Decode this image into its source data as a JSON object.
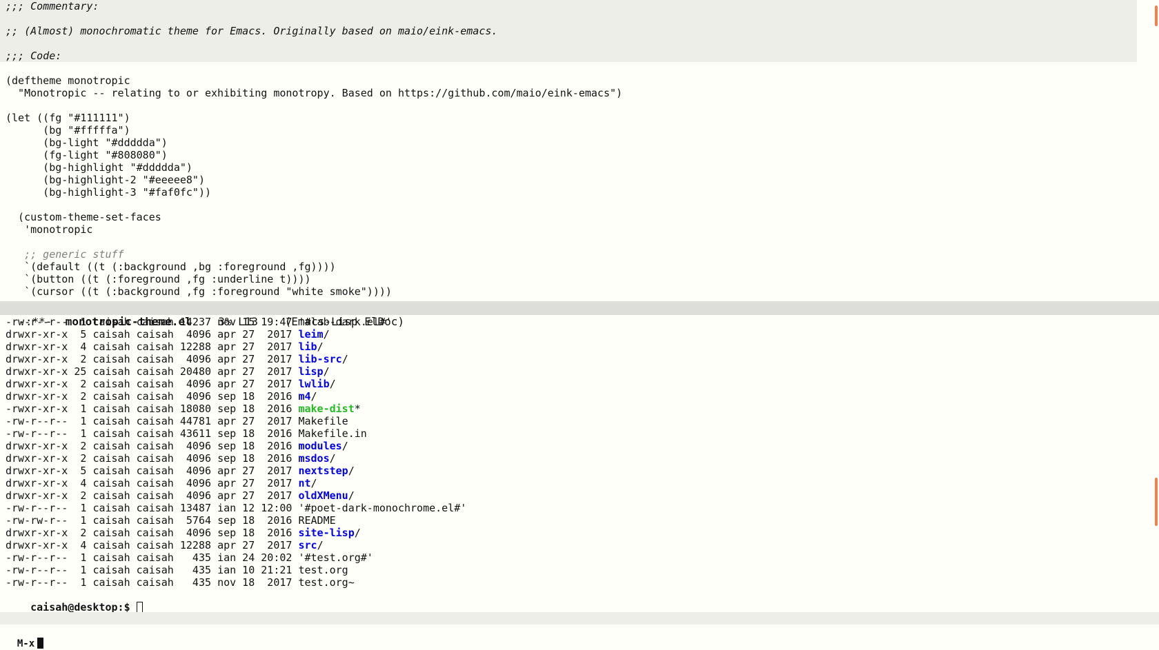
{
  "editor": {
    "commentary_lines": [
      ";;; Commentary:",
      "",
      ";; (Almost) monochromatic theme for Emacs. Originally based on maio/eink-emacs.",
      "",
      ";;; Code:"
    ],
    "code_lines": [
      "",
      "(deftheme monotropic",
      "  \"Monotropic -- relating to or exhibiting monotropy. Based on https://github.com/maio/eink-emacs\")",
      "",
      "(let ((fg \"#111111\")",
      "      (bg \"#fffffa\")",
      "      (bg-light \"#ddddda\")",
      "      (fg-light \"#808080\")",
      "      (bg-highlight \"#ddddda\")",
      "      (bg-highlight-2 \"#eeeee8\")",
      "      (bg-highlight-3 \"#faf0fc\"))",
      "",
      "  (custom-theme-set-faces",
      "   'monotropic",
      ""
    ],
    "generic_comment": "   ;; generic stuff",
    "face_lines": [
      "   `(default ((t (:background ,bg :foreground ,fg))))",
      "   `(button ((t (:foreground ,fg :underline t))))",
      "   `(cursor ((t (:background ,fg :foreground \"white smoke\"))))"
    ]
  },
  "modeline": {
    "status": "-:**-  ",
    "buffer_name": "monotropic-theme.el",
    "position": "    3% L13    ",
    "modes": "(Emacs-Lisp ElDoc)"
  },
  "shell": {
    "listing": [
      {
        "perms": "-rw-r--r--",
        "links": " 1",
        "user": "caisah",
        "group": "caisah",
        "size": "14237",
        "date": "nov 15 19:47",
        "name": "'#lab-dark.el#'",
        "kind": "file",
        "suffix": ""
      },
      {
        "perms": "drwxr-xr-x",
        "links": " 5",
        "user": "caisah",
        "group": "caisah",
        "size": " 4096",
        "date": "apr 27  2017",
        "name": "leim",
        "kind": "dir",
        "suffix": "/"
      },
      {
        "perms": "drwxr-xr-x",
        "links": " 4",
        "user": "caisah",
        "group": "caisah",
        "size": "12288",
        "date": "apr 27  2017",
        "name": "lib",
        "kind": "dir",
        "suffix": "/"
      },
      {
        "perms": "drwxr-xr-x",
        "links": " 2",
        "user": "caisah",
        "group": "caisah",
        "size": " 4096",
        "date": "apr 27  2017",
        "name": "lib-src",
        "kind": "dir",
        "suffix": "/"
      },
      {
        "perms": "drwxr-xr-x",
        "links": "25",
        "user": "caisah",
        "group": "caisah",
        "size": "20480",
        "date": "apr 27  2017",
        "name": "lisp",
        "kind": "dir",
        "suffix": "/"
      },
      {
        "perms": "drwxr-xr-x",
        "links": " 2",
        "user": "caisah",
        "group": "caisah",
        "size": " 4096",
        "date": "apr 27  2017",
        "name": "lwlib",
        "kind": "dir",
        "suffix": "/"
      },
      {
        "perms": "drwxr-xr-x",
        "links": " 2",
        "user": "caisah",
        "group": "caisah",
        "size": " 4096",
        "date": "sep 18  2016",
        "name": "m4",
        "kind": "dir",
        "suffix": "/"
      },
      {
        "perms": "-rwxr-xr-x",
        "links": " 1",
        "user": "caisah",
        "group": "caisah",
        "size": "18080",
        "date": "sep 18  2016",
        "name": "make-dist",
        "kind": "exe",
        "suffix": "*"
      },
      {
        "perms": "-rw-r--r--",
        "links": " 1",
        "user": "caisah",
        "group": "caisah",
        "size": "44781",
        "date": "apr 27  2017",
        "name": "Makefile",
        "kind": "file",
        "suffix": ""
      },
      {
        "perms": "-rw-r--r--",
        "links": " 1",
        "user": "caisah",
        "group": "caisah",
        "size": "43611",
        "date": "sep 18  2016",
        "name": "Makefile.in",
        "kind": "file",
        "suffix": ""
      },
      {
        "perms": "drwxr-xr-x",
        "links": " 2",
        "user": "caisah",
        "group": "caisah",
        "size": " 4096",
        "date": "sep 18  2016",
        "name": "modules",
        "kind": "dir",
        "suffix": "/"
      },
      {
        "perms": "drwxr-xr-x",
        "links": " 2",
        "user": "caisah",
        "group": "caisah",
        "size": " 4096",
        "date": "sep 18  2016",
        "name": "msdos",
        "kind": "dir",
        "suffix": "/"
      },
      {
        "perms": "drwxr-xr-x",
        "links": " 5",
        "user": "caisah",
        "group": "caisah",
        "size": " 4096",
        "date": "apr 27  2017",
        "name": "nextstep",
        "kind": "dir",
        "suffix": "/"
      },
      {
        "perms": "drwxr-xr-x",
        "links": " 4",
        "user": "caisah",
        "group": "caisah",
        "size": " 4096",
        "date": "apr 27  2017",
        "name": "nt",
        "kind": "dir",
        "suffix": "/"
      },
      {
        "perms": "drwxr-xr-x",
        "links": " 2",
        "user": "caisah",
        "group": "caisah",
        "size": " 4096",
        "date": "apr 27  2017",
        "name": "oldXMenu",
        "kind": "dir",
        "suffix": "/"
      },
      {
        "perms": "-rw-r--r--",
        "links": " 1",
        "user": "caisah",
        "group": "caisah",
        "size": "13487",
        "date": "ian 12 12:00",
        "name": "'#poet-dark-monochrome.el#'",
        "kind": "file",
        "suffix": ""
      },
      {
        "perms": "-rw-rw-r--",
        "links": " 1",
        "user": "caisah",
        "group": "caisah",
        "size": " 5764",
        "date": "sep 18  2016",
        "name": "README",
        "kind": "file",
        "suffix": ""
      },
      {
        "perms": "drwxr-xr-x",
        "links": " 2",
        "user": "caisah",
        "group": "caisah",
        "size": " 4096",
        "date": "sep 18  2016",
        "name": "site-lisp",
        "kind": "dir",
        "suffix": "/"
      },
      {
        "perms": "drwxr-xr-x",
        "links": " 4",
        "user": "caisah",
        "group": "caisah",
        "size": "12288",
        "date": "apr 27  2017",
        "name": "src",
        "kind": "dir",
        "suffix": "/"
      },
      {
        "perms": "-rw-r--r--",
        "links": " 1",
        "user": "caisah",
        "group": "caisah",
        "size": "  435",
        "date": "ian 24 20:02",
        "name": "'#test.org#'",
        "kind": "file",
        "suffix": ""
      },
      {
        "perms": "-rw-r--r--",
        "links": " 1",
        "user": "caisah",
        "group": "caisah",
        "size": "  435",
        "date": "ian 10 21:21",
        "name": "test.org",
        "kind": "file",
        "suffix": ""
      },
      {
        "perms": "-rw-r--r--",
        "links": " 1",
        "user": "caisah",
        "group": "caisah",
        "size": "  435",
        "date": "nov 18  2017",
        "name": "test.org~",
        "kind": "file",
        "suffix": ""
      }
    ],
    "prompt": "caisah@desktop:$ "
  },
  "minibuffer": {
    "text": "M-x"
  },
  "colors": {
    "fg": "#111111",
    "bg": "#fffffa",
    "modeline_bg": "#ddddda",
    "highlight_bg": "#eeeee8",
    "dir": "#0000ee",
    "exe": "#22bb22",
    "scroll_indicator": "#f08050"
  }
}
